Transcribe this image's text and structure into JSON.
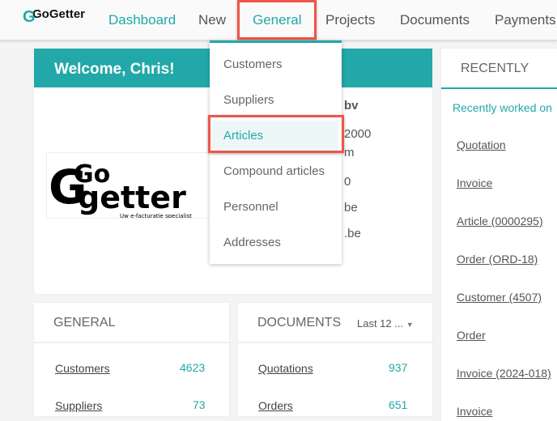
{
  "nav": {
    "logo": "GoGetter",
    "items": [
      "Dashboard",
      "New",
      "General",
      "Projects",
      "Documents",
      "Payments"
    ],
    "active": "Dashboard",
    "open": "General"
  },
  "welcome": {
    "title": "Welcome, Chris!",
    "logo_text": "GoGetter",
    "logo_tagline": "Uw e-facturatie specialist",
    "fragments": [
      "bv",
      "2000",
      "m",
      "0",
      "be",
      ".be"
    ]
  },
  "dropdown": {
    "items": [
      "Customers",
      "Suppliers",
      "Articles",
      "Compound articles",
      "Personnel",
      "Addresses"
    ],
    "highlighted": "Articles"
  },
  "recently": {
    "title": "RECENTLY",
    "subtitle": "Recently worked on",
    "items": [
      "Quotation",
      "Invoice",
      "Article (0000295)",
      "Order (ORD-18)",
      "Customer (4507)",
      "Order",
      "Invoice (2024-018)",
      "Invoice"
    ]
  },
  "general": {
    "title": "GENERAL",
    "rows": [
      {
        "label": "Customers",
        "value": "4623"
      },
      {
        "label": "Suppliers",
        "value": "73"
      }
    ]
  },
  "documents": {
    "title": "DOCUMENTS",
    "period": "Last 12 ...",
    "rows": [
      {
        "label": "Quotations",
        "value": "937"
      },
      {
        "label": "Orders",
        "value": "651"
      }
    ]
  },
  "colors": {
    "accent": "#22a8a8",
    "highlight": "#f0554a"
  }
}
